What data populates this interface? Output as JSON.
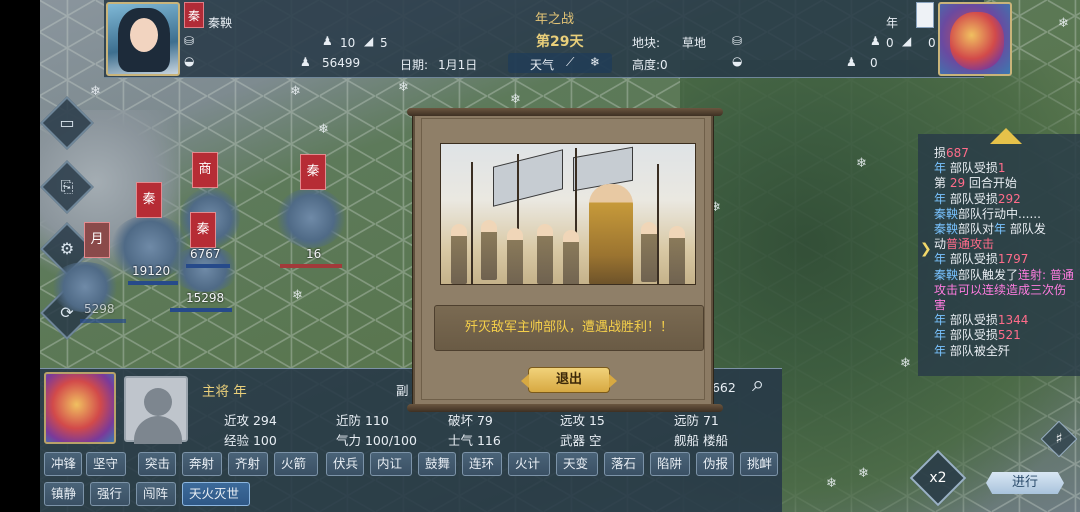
{
  "top": {
    "left_faction": "秦",
    "left_general": "秦鞅",
    "left_soldiers_a": "10",
    "left_soldiers_b": "5",
    "left_troops": "56499",
    "date_label": "日期:",
    "date_value": "1月1日",
    "battle_title": "年之战",
    "day": "第29天",
    "weather_label": "天气",
    "terrain_label": "地块:",
    "terrain_value": "草地",
    "height_label": "高度:0",
    "right_general": "年",
    "right_soldiers_a": "0",
    "right_soldiers_b": "0",
    "right_troops": "0"
  },
  "map_units": {
    "banner_shang": "商",
    "banner_qin1": "秦",
    "banner_qin2": "秦",
    "banner_qin3": "秦",
    "banner_yue": "月",
    "count_19120": "19120",
    "count_6767": "6767",
    "count_16": "16",
    "count_15298": "15298",
    "count_5298": "5298"
  },
  "log": [
    {
      "parts": [
        [
          "c-white",
          "损"
        ],
        [
          "c-red",
          "687"
        ]
      ]
    },
    {
      "parts": [
        [
          "c-blue",
          "年"
        ],
        [
          "c-white",
          " 部队受损"
        ],
        [
          "c-red",
          "1"
        ]
      ]
    },
    {
      "parts": [
        [
          "c-white",
          "第 "
        ],
        [
          "c-red",
          "29"
        ],
        [
          "c-white",
          " 回合开始"
        ]
      ]
    },
    {
      "parts": [
        [
          "c-blue",
          "年"
        ],
        [
          "c-white",
          " 部队受损"
        ],
        [
          "c-red",
          "292"
        ]
      ]
    },
    {
      "parts": [
        [
          "c-blue",
          "秦鞅"
        ],
        [
          "c-white",
          "部队行动中......"
        ]
      ]
    },
    {
      "parts": [
        [
          "c-blue",
          "秦鞅"
        ],
        [
          "c-white",
          "部队对"
        ],
        [
          "c-blue",
          "年"
        ],
        [
          "c-white",
          " 部队发"
        ]
      ]
    },
    {
      "parts": [
        [
          "c-white",
          "动"
        ],
        [
          "c-red",
          "普通攻击"
        ]
      ]
    },
    {
      "parts": [
        [
          "c-blue",
          "年"
        ],
        [
          "c-white",
          " 部队受损"
        ],
        [
          "c-red",
          "1797"
        ]
      ]
    },
    {
      "parts": [
        [
          "c-blue",
          "秦鞅"
        ],
        [
          "c-white",
          "部队触发了"
        ],
        [
          "c-pink",
          "连射: 普通攻击可以连续造成三次伤害"
        ]
      ]
    },
    {
      "parts": [
        [
          "c-blue",
          "年"
        ],
        [
          "c-white",
          " 部队受损"
        ],
        [
          "c-red",
          "1344"
        ]
      ]
    },
    {
      "parts": [
        [
          "c-blue",
          "年"
        ],
        [
          "c-white",
          " 部队受损"
        ],
        [
          "c-red",
          "521"
        ]
      ]
    },
    {
      "parts": [
        [
          "c-blue",
          "年"
        ],
        [
          "c-white",
          " 部队被全歼"
        ]
      ]
    }
  ],
  "modal": {
    "message": "歼灭敌军主帅部队，遭遇战胜利！！",
    "exit_label": "退出"
  },
  "bottom": {
    "commander": "主将 年",
    "deputy": "副",
    "value_3662": "3662",
    "stats": {
      "melee_atk": "近攻 294",
      "melee_def": "近防 110",
      "destroy": "破坏 79",
      "ranged_atk": "远攻 15",
      "ranged_def": "远防 71",
      "exp": "经验 100",
      "energy": "气力 100/100",
      "morale": "士气 116",
      "weapon": "武器 空",
      "ship": "舰船 楼船"
    },
    "skills_row1": [
      "冲锋",
      "坚守",
      "突击",
      "奔射",
      "齐射",
      "火箭",
      "伏兵",
      "内讧",
      "鼓舞",
      "连环",
      "火计",
      "天变",
      "落石",
      "陷阱",
      "伪报",
      "挑衅"
    ],
    "skills_row2": [
      "镇静",
      "强行",
      "闯阵",
      "天火灭世"
    ]
  },
  "controls": {
    "speed": "x2",
    "advance": "进行"
  },
  "colors": {
    "faction_red": "#b62c35",
    "panel": "#283a48",
    "scroll": "#8c7b64",
    "gold_text": "#f4cf4a"
  }
}
